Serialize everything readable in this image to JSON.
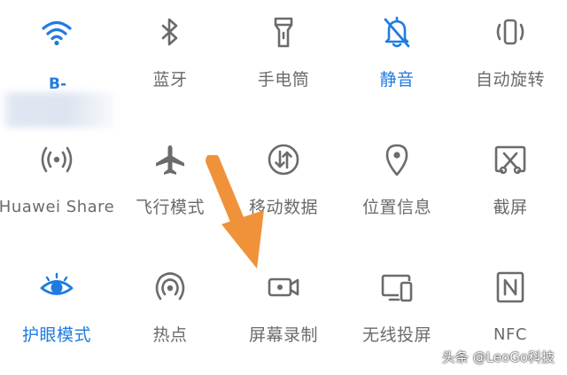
{
  "colors": {
    "active": "#1f7be0",
    "inactive": "#6b6b6b",
    "arrow": "#f0923a"
  },
  "tiles": [
    {
      "label": "B-",
      "icon": "wifi-icon",
      "active": true
    },
    {
      "label": "蓝牙",
      "icon": "bluetooth-icon",
      "active": false
    },
    {
      "label": "手电筒",
      "icon": "flashlight-icon",
      "active": false
    },
    {
      "label": "静音",
      "icon": "bell-off-icon",
      "active": true
    },
    {
      "label": "自动旋转",
      "icon": "auto-rotate-icon",
      "active": false
    },
    {
      "label": "Huawei Share",
      "icon": "huawei-share-icon",
      "active": false
    },
    {
      "label": "飞行模式",
      "icon": "airplane-icon",
      "active": false
    },
    {
      "label": "移动数据",
      "icon": "mobile-data-icon",
      "active": false
    },
    {
      "label": "位置信息",
      "icon": "location-icon",
      "active": false
    },
    {
      "label": "截屏",
      "icon": "screenshot-icon",
      "active": false
    },
    {
      "label": "护眼模式",
      "icon": "eye-icon",
      "active": true
    },
    {
      "label": "热点",
      "icon": "hotspot-icon",
      "active": false
    },
    {
      "label": "屏幕录制",
      "icon": "screen-record-icon",
      "active": false
    },
    {
      "label": "无线投屏",
      "icon": "wireless-projection-icon",
      "active": false
    },
    {
      "label": "NFC",
      "icon": "nfc-icon",
      "active": false
    }
  ],
  "watermark": "头条 @LeoGo科技"
}
